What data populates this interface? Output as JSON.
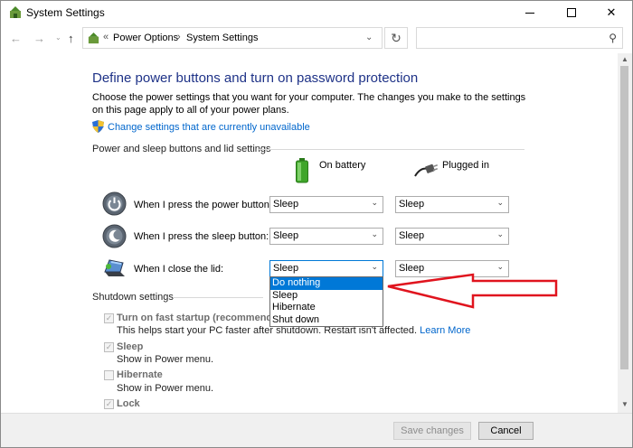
{
  "window": {
    "title": "System Settings",
    "controls": {
      "minimize": "",
      "maximize": "",
      "close": "✕"
    }
  },
  "nav": {
    "back": "←",
    "forward": "→",
    "recent": "⌄",
    "up": "↑",
    "breadcrumb_sep": "«",
    "breadcrumb_arrow": "›",
    "crumbs": [
      "Power Options",
      "System Settings"
    ],
    "address_dropdown": "⌄",
    "refresh": "↻",
    "search_placeholder": "",
    "search_icon": "⚲"
  },
  "main": {
    "heading": "Define power buttons and turn on password protection",
    "description": "Choose the power settings that you want for your computer. The changes you make to the settings on this page apply to all of your power plans.",
    "change_link": "Change settings that are currently unavailable",
    "section_power": "Power and sleep buttons and lid settings",
    "col_battery": "On battery",
    "col_plugged": "Plugged in",
    "rows": [
      {
        "label": "When I press the power button:",
        "battery": "Sleep",
        "plugged": "Sleep"
      },
      {
        "label": "When I press the sleep button:",
        "battery": "Sleep",
        "plugged": "Sleep"
      },
      {
        "label": "When I close the lid:",
        "battery": "Sleep",
        "plugged": "Sleep"
      }
    ],
    "dropdown_options": [
      "Do nothing",
      "Sleep",
      "Hibernate",
      "Shut down"
    ],
    "dropdown_highlighted": "Do nothing",
    "section_shutdown": "Shutdown settings",
    "shutdown": [
      {
        "label": "Turn on fast startup (recommended)",
        "checked": true,
        "sub": "This helps start your PC faster after shutdown. Restart isn't affected.",
        "link": "Learn More"
      },
      {
        "label": "Sleep",
        "checked": true,
        "sub": "Show in Power menu."
      },
      {
        "label": "Hibernate",
        "checked": false,
        "sub": "Show in Power menu."
      },
      {
        "label": "Lock",
        "checked": true,
        "sub": ""
      }
    ],
    "check_mark": "✓"
  },
  "footer": {
    "save": "Save changes",
    "cancel": "Cancel"
  },
  "scroll": {
    "up": "▲",
    "down": "▼"
  },
  "colors": {
    "heading": "#1e3287",
    "link": "#0066cc",
    "highlight": "#0078d7",
    "annotation_arrow": "#e0141e"
  }
}
